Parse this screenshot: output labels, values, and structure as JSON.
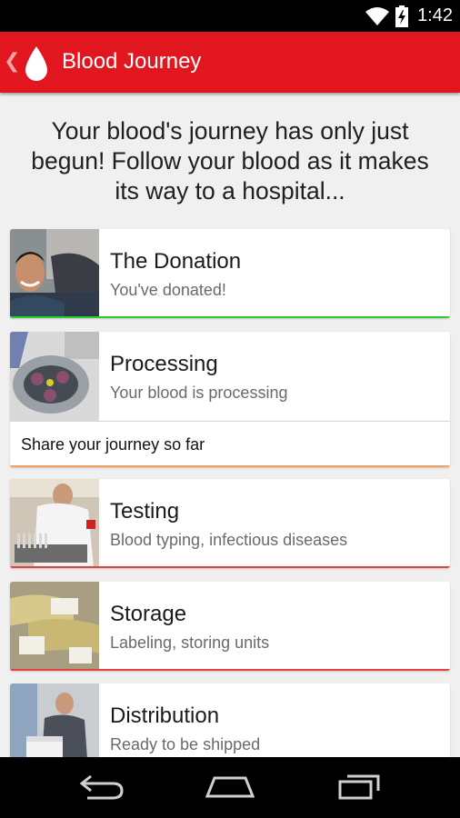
{
  "status_bar": {
    "time": "1:42",
    "icons": [
      "wifi-icon",
      "battery-charging-icon"
    ]
  },
  "app_bar": {
    "title": "Blood Journey",
    "back_icon": "chevron-left-icon",
    "logo_icon": "blood-drop-icon",
    "color": "#e1161f"
  },
  "intro": {
    "text": "Your blood's journey has only just begun! Follow your blood as it makes its way to a hospital..."
  },
  "steps": [
    {
      "title": "The Donation",
      "subtitle": "You've donated!",
      "bar_color": "#2ecc2e"
    },
    {
      "title": "Processing",
      "subtitle": "Your blood is processing",
      "bar_color": "#f0a060",
      "share_label": "Share your journey so far"
    },
    {
      "title": "Testing",
      "subtitle": "Blood typing, infectious diseases",
      "bar_color": "#e84040"
    },
    {
      "title": "Storage",
      "subtitle": "Labeling, storing units",
      "bar_color": "#e84040"
    },
    {
      "title": "Distribution",
      "subtitle": "Ready to be shipped",
      "bar_color": "#e84040"
    }
  ],
  "nav_bar": {
    "icons": [
      "back-icon",
      "home-icon",
      "recents-icon"
    ]
  }
}
